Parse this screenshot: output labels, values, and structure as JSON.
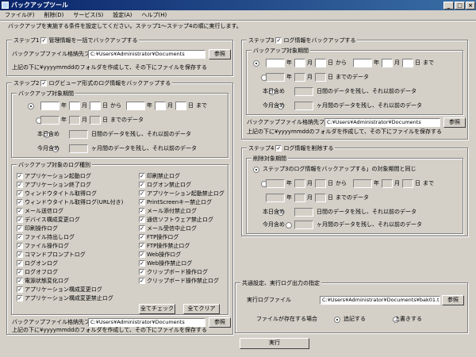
{
  "app": {
    "title": "バックアップツール"
  },
  "menu": [
    "ファイル(F)",
    "削除(D)",
    "サービス(S)",
    "設定(A)",
    "ヘルプ(H)"
  ],
  "intro": "バックアップを実施する条件を設定してください。ステップ1～ステップ4の順に実行します。",
  "step1": {
    "title": "ステップ1",
    "check_label": "管理情報を一括でバックアップする",
    "folder_label": "バックアップファイル格納先フォルダ",
    "folder_value": "C:¥Users¥Administrator¥Documents",
    "browse": "参照",
    "note": "上記の下に¥yyyymmddのフォルダを作成して、その下にファイルを保存する"
  },
  "step2": {
    "title": "ステップ2",
    "check_label": "ログビューア形式のログ情報をバックアップする",
    "period_title": "バックアップ対象期間",
    "year": "年",
    "month": "月",
    "day": "日",
    "from": "から",
    "until": "まで",
    "until_data": "までのデータ",
    "today_incl": "本日含め",
    "today_text": "日間のデータを残し、それ以前のデータ",
    "month_incl": "今月含め",
    "month_text": "ヶ月間のデータを残し、それ以前のデータ",
    "types_title": "バックアップ対象のログ種別",
    "types_left": [
      "アプリケーション起動ログ",
      "アプリケーション終了ログ",
      "ウィンドウタイトル取得ログ",
      "ウィンドウタイトル取得ログ(URL付き)",
      "メール送信ログ",
      "デバイス構成変更ログ",
      "印刷操作ログ",
      "ファイル持出しログ",
      "ファイル操作ログ",
      "コマンドプロンプトログ",
      "ログオンログ",
      "ログオフログ",
      "電源状態変化ログ",
      "アプリケーション構成変更ログ",
      "アプリケーション構成変更禁止ログ"
    ],
    "types_right": [
      "印刷禁止ログ",
      "ログオン禁止ログ",
      "アプリケーション起動禁止ログ",
      "PrintScreenキー禁止ログ",
      "メール添付禁止ログ",
      "通信ソフトウェア禁止ログ",
      "メール受信中止ログ",
      "FTP操作ログ",
      "FTP操作禁止ログ",
      "Web操作ログ",
      "Web操作禁止ログ",
      "クリップボード操作ログ",
      "クリップボード操作禁止ログ"
    ],
    "check_all": "全てチェック",
    "clear_all": "全てクリア",
    "folder_label": "バックアップファイル格納先フォルダ",
    "folder_value": "C:¥Users¥Administrator¥Documents",
    "browse": "参照",
    "note": "上記の下に¥yyyymmddのフォルダを作成して、その下にファイルを保存する"
  },
  "step3": {
    "title": "ステップ3",
    "check_label": "ログ情報をバックアップする",
    "period_title": "バックアップ対象期間",
    "folder_label": "バックアップファイル格納先フォルダ",
    "folder_value": "C:¥Users¥Administrator¥Documents",
    "browse": "参照",
    "note": "上記の下に¥yyyymmddのフォルダを作成して、その下にファイルを保存する"
  },
  "step4": {
    "title": "ステップ4",
    "check_label": "ログ情報を削除する",
    "period_title": "削除対象期間",
    "same_label": "ステップ3のログ情報をバックアップする」の対象期間と同じ"
  },
  "common": {
    "title": "共通設定、実行ログ出力の指定",
    "log_label": "実行ログファイル",
    "log_value": "C:¥Users¥Administrator¥Documents¥bak01.txt",
    "browse": "参照",
    "exists_label": "ファイルが存在する場合",
    "append": "追記する",
    "overwrite": "上書きする"
  },
  "run": "実行"
}
